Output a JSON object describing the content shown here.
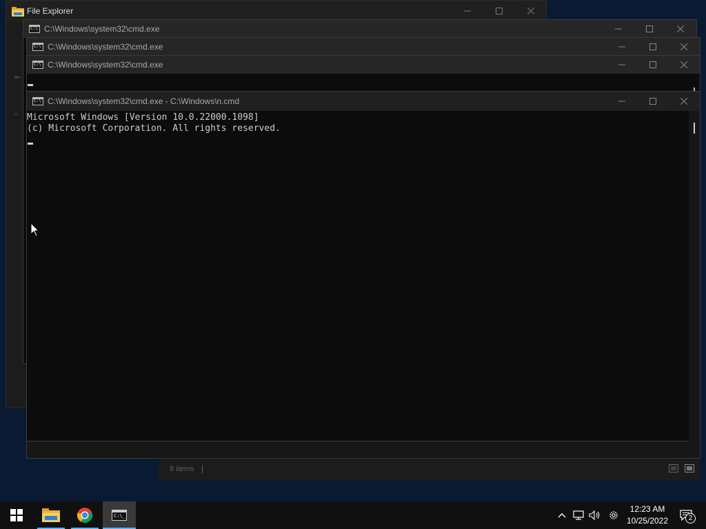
{
  "explorer": {
    "title": "File Explorer",
    "status_items": "8 items"
  },
  "cmd_windows": [
    {
      "title": "C:\\Windows\\system32\\cmd.exe"
    },
    {
      "title": "C:\\Windows\\system32\\cmd.exe"
    },
    {
      "title": "C:\\Windows\\system32\\cmd.exe"
    }
  ],
  "active_cmd": {
    "title": "C:\\Windows\\system32\\cmd.exe - C:\\Windows\\n.cmd",
    "lines": [
      "Microsoft Windows [Version 10.0.22000.1098]",
      "(c) Microsoft Corporation. All rights reserved."
    ]
  },
  "taskbar": {
    "apps": [
      {
        "name": "file-explorer",
        "icon": "folder-icon"
      },
      {
        "name": "chrome",
        "icon": "chrome-icon"
      },
      {
        "name": "command-prompt",
        "icon": "cmd-icon"
      }
    ],
    "clock": {
      "time": "12:23 AM",
      "date": "10/25/2022"
    },
    "notification_count": "2"
  },
  "colors": {
    "desktop": "#0b1a33",
    "taskbar": "#101010",
    "console_bg": "#0c0c0c",
    "titlebar": "#202020",
    "accent_underline": "#5ab0ff"
  }
}
